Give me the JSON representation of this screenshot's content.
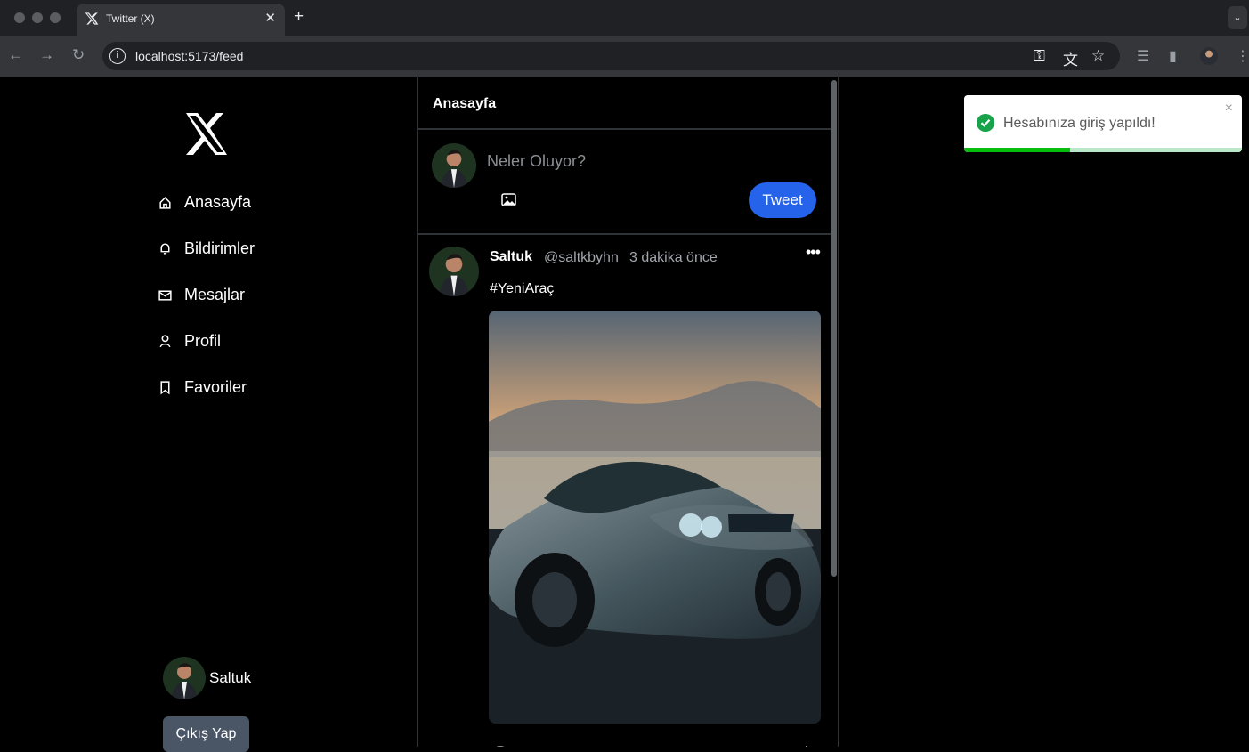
{
  "browser": {
    "tab_title": "Twitter (X)",
    "url": "localhost:5173/feed",
    "icons": [
      "back-icon",
      "forward-icon",
      "reload-icon",
      "site-info-icon",
      "key-icon",
      "translate-icon",
      "star-icon",
      "reading-list-icon",
      "side-panel-icon",
      "profile-icon",
      "menu-icon"
    ]
  },
  "sidebar": {
    "items": [
      {
        "label": "Anasayfa",
        "icon": "home-icon"
      },
      {
        "label": "Bildirimler",
        "icon": "bell-icon"
      },
      {
        "label": "Mesajlar",
        "icon": "mail-icon"
      },
      {
        "label": "Profil",
        "icon": "user-icon"
      },
      {
        "label": "Favoriler",
        "icon": "bookmark-icon"
      }
    ],
    "user_name": "Saltuk",
    "logout_label": "Çıkış Yap"
  },
  "feed": {
    "title": "Anasayfa",
    "compose": {
      "placeholder": "Neler Oluyor?",
      "button_label": "Tweet"
    },
    "post": {
      "author": "Saltuk",
      "handle": "@saltkbyhn",
      "time": "3 dakika önce",
      "text": "#YeniAraç",
      "menu": "•••",
      "image_subject": "gray sports car on road at sunset"
    }
  },
  "toast": {
    "message": "Hesabınıza giriş yapıldı!",
    "close_label": "×",
    "progress": 0.38
  },
  "colors": {
    "accent_blue": "#2563eb",
    "success_green": "#16a34a",
    "background": "#000000",
    "logout_button": "#4a5565"
  }
}
